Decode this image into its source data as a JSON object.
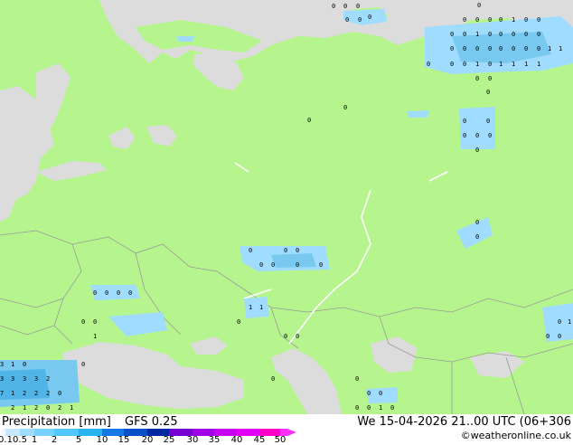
{
  "title": {
    "product": "Precipitation [mm]",
    "model": "GFS 0.25",
    "valid_time": "We 15-04-2026 21..00 UTC (06+306",
    "credit": "©weatheronline.co.uk"
  },
  "legend": {
    "ticks": [
      "0.1",
      "0.5",
      "1",
      "2",
      "5",
      "10",
      "15",
      "20",
      "25",
      "30",
      "35",
      "40",
      "45",
      "50"
    ],
    "colors": [
      "#f5f5ff",
      "#c8e8ff",
      "#a0dcff",
      "#78d2ff",
      "#50c8ff",
      "#28b4f0",
      "#1478e6",
      "#0a50c8",
      "#0028a0",
      "#7800d2",
      "#a000e6",
      "#c800f0",
      "#e100fa",
      "#ff00c8",
      "#ff30ff"
    ]
  },
  "colors": {
    "land": "#b6f58e",
    "sea": "#dcdcdc",
    "border": "#9a9a9a",
    "river": "#ffffff",
    "precip_light": "#a0dcff",
    "precip_mid": "#78c8f0",
    "precip_heavy": "#50b4e6"
  },
  "map_numbers": [
    {
      "group": "kola",
      "labels": [
        "0",
        "0",
        "0",
        "0",
        "0",
        "0",
        "0"
      ]
    },
    {
      "group": "ural-north",
      "labels": [
        "0",
        "0",
        "0",
        "1",
        "0",
        "0",
        "0",
        "0",
        "0",
        "0",
        "0",
        "0",
        "0",
        "1",
        "1",
        "0",
        "0",
        "0",
        "1",
        "0",
        "1",
        "1",
        "1",
        "1",
        "1"
      ]
    },
    {
      "group": "central",
      "labels": [
        "0",
        "0",
        "0",
        "0",
        "0",
        "0",
        "0",
        "0"
      ]
    },
    {
      "group": "south",
      "labels": [
        "0",
        "0",
        "0",
        "0",
        "0",
        "0",
        "1",
        "1",
        "0",
        "0",
        "0"
      ]
    },
    {
      "group": "caucasus",
      "labels": [
        "3",
        "3",
        "3",
        "3",
        "2",
        "7",
        "1",
        "2",
        "2",
        "2",
        "0",
        "2",
        "1"
      ]
    }
  ]
}
